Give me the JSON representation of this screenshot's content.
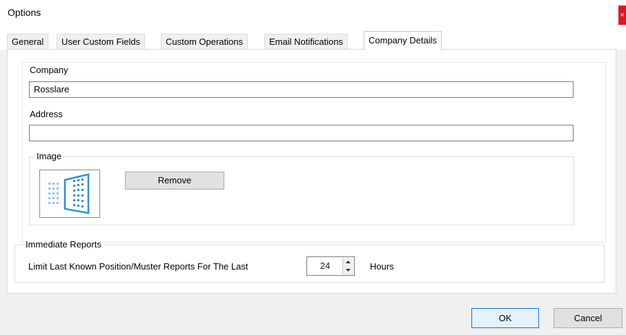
{
  "window": {
    "title": "Options",
    "close_glyph": "×"
  },
  "tabs": [
    {
      "label": "General",
      "active": false
    },
    {
      "label": "User Custom Fields",
      "active": false
    },
    {
      "label": "Custom Operations",
      "active": false
    },
    {
      "label": "Email Notifications",
      "active": false
    },
    {
      "label": "Company Details",
      "active": true
    }
  ],
  "company": {
    "label": "Company",
    "value": "Rosslare"
  },
  "address": {
    "label": "Address",
    "value": ""
  },
  "image_group": {
    "legend": "Image",
    "remove_label": "Remove",
    "icon": "building-logo-icon"
  },
  "reports_group": {
    "legend": "Immediate Reports",
    "limit_label": "Limit Last Known Position/Muster Reports For The Last",
    "hours_value": "24",
    "unit_label": "Hours"
  },
  "footer": {
    "ok_label": "OK",
    "cancel_label": "Cancel"
  },
  "colors": {
    "accent": "#0078d7",
    "logo_blue": "#2e8fd6",
    "close_red": "#e81123"
  }
}
